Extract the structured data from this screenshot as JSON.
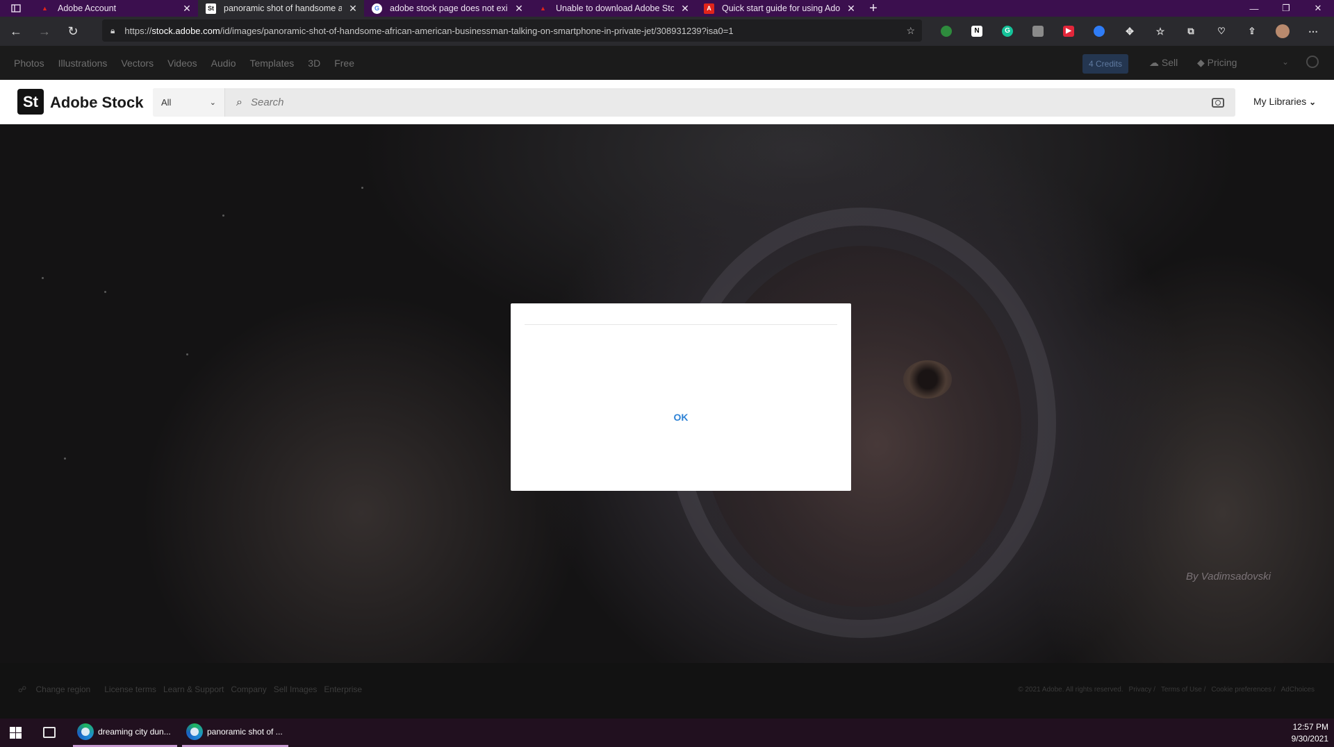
{
  "browser": {
    "tabs": [
      {
        "title": "Adobe Account",
        "icon": "adobe-icon",
        "active": false
      },
      {
        "title": "panoramic shot of handsome afr",
        "icon": "adobe-stock-icon",
        "active": true
      },
      {
        "title": "adobe stock page does not exist",
        "icon": "google-icon",
        "active": false
      },
      {
        "title": "Unable to download Adobe Stoc",
        "icon": "adobe-icon",
        "active": false
      },
      {
        "title": "Quick start guide for using Adob",
        "icon": "adobe-red-icon",
        "active": false
      }
    ],
    "url_host": "stock.adobe.com",
    "url_prefix": "https://",
    "url_path": "/id/images/panoramic-shot-of-handsome-african-american-businessman-talking-on-smartphone-in-private-jet/308931239?isa0=1"
  },
  "stock_topbar": {
    "categories": [
      "Photos",
      "Illustrations",
      "Vectors",
      "Videos",
      "Audio",
      "Templates",
      "3D",
      "Free"
    ],
    "credits": "4 Credits",
    "sell": "Sell",
    "pricing": "Pricing"
  },
  "header": {
    "logo_badge": "St",
    "logo_text": "Adobe Stock",
    "scope": "All",
    "search_placeholder": "Search",
    "my_libraries": "My Libraries"
  },
  "hero": {
    "credit": "By Vadimsadovski"
  },
  "modal": {
    "ok_label": "OK"
  },
  "footer": {
    "links": [
      "Change region",
      "License terms",
      "Learn & Support",
      "Company",
      "Sell Images",
      "Enterprise"
    ],
    "legal": [
      "© 2021 Adobe. All rights reserved.",
      "Privacy /",
      "Terms of Use /",
      "Cookie preferences /",
      "AdChoices"
    ]
  },
  "taskbar": {
    "apps": [
      "dreaming city dun...",
      "panoramic shot of ..."
    ],
    "time": "12:57 PM",
    "date": "9/30/2021"
  },
  "colors": {
    "tabstrip": "#3b0f4e",
    "modal_ok": "#2d82d6",
    "taskbar": "#21101f"
  }
}
